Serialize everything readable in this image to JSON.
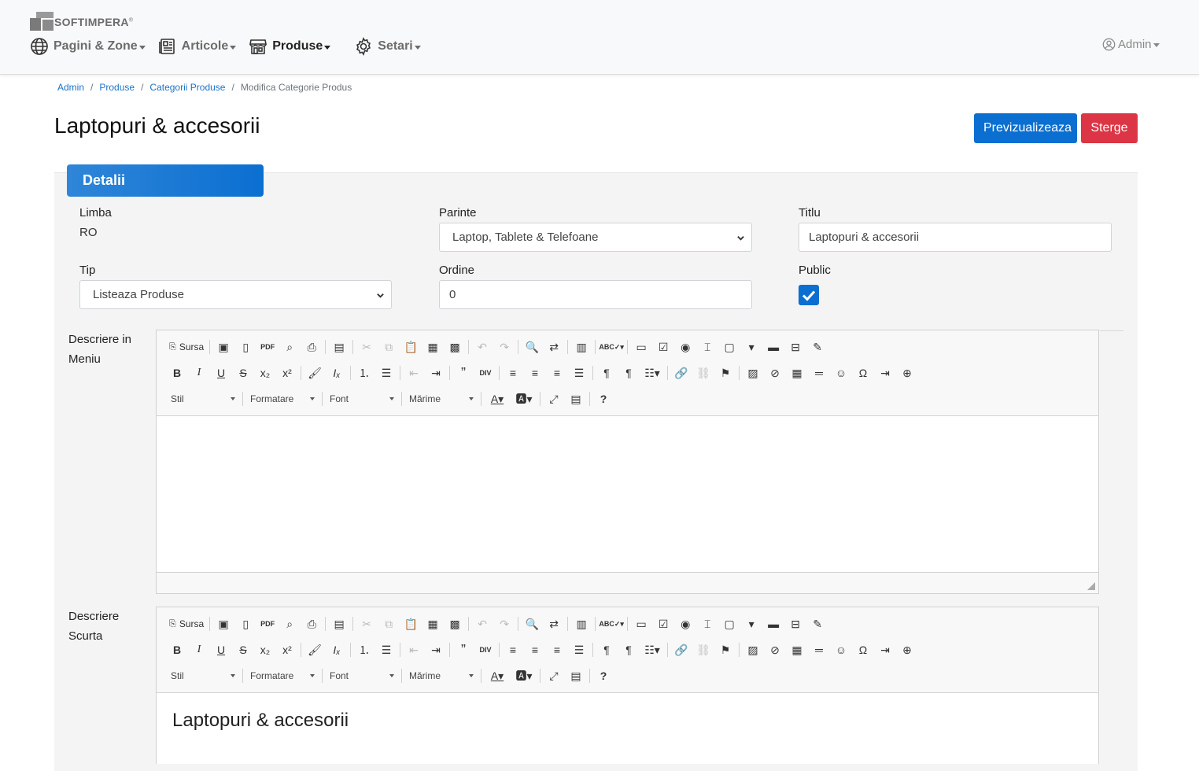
{
  "brand": {
    "name": "SOFTIMPERA",
    "reg": "®"
  },
  "nav": {
    "items": [
      {
        "label": "Pagini & Zone",
        "icon": "globe-icon"
      },
      {
        "label": "Articole",
        "icon": "articles-icon"
      },
      {
        "label": "Produse",
        "icon": "store-icon",
        "active": true
      },
      {
        "label": "Setari",
        "icon": "gear-icon"
      }
    ],
    "user": "Admin"
  },
  "breadcrumb": [
    "Admin",
    "Produse",
    "Categorii Produse",
    "Modifica Categorie Produs"
  ],
  "page": {
    "title": "Laptopuri & accesorii",
    "preview_label": "Previzualizeaza",
    "delete_label": "Sterge"
  },
  "panel": {
    "tab_label": "Detalii"
  },
  "form": {
    "limba": {
      "label": "Limba",
      "value": "RO"
    },
    "parinte": {
      "label": "Parinte",
      "value": "Laptop, Tablete & Telefoane"
    },
    "titlu": {
      "label": "Titlu",
      "value": "Laptopuri & accesorii"
    },
    "tip": {
      "label": "Tip",
      "value": "Listeaza Produse"
    },
    "ordine": {
      "label": "Ordine",
      "value": "0"
    },
    "public": {
      "label": "Public",
      "checked": true
    }
  },
  "editors": {
    "menu": {
      "label_line1": "Descriere in",
      "label_line2": "Meniu",
      "content": ""
    },
    "short": {
      "label_line1": "Descriere",
      "label_line2": "Scurta",
      "content": "Laptopuri & accesorii"
    },
    "toolbar": {
      "source_label": "Sursa",
      "style_label": "Stil",
      "format_label": "Formatare",
      "font_label": "Font",
      "size_label": "Mărime"
    }
  },
  "colors": {
    "primary": "#0b6fd1",
    "danger": "#dc3545",
    "link": "#1a73c9"
  }
}
